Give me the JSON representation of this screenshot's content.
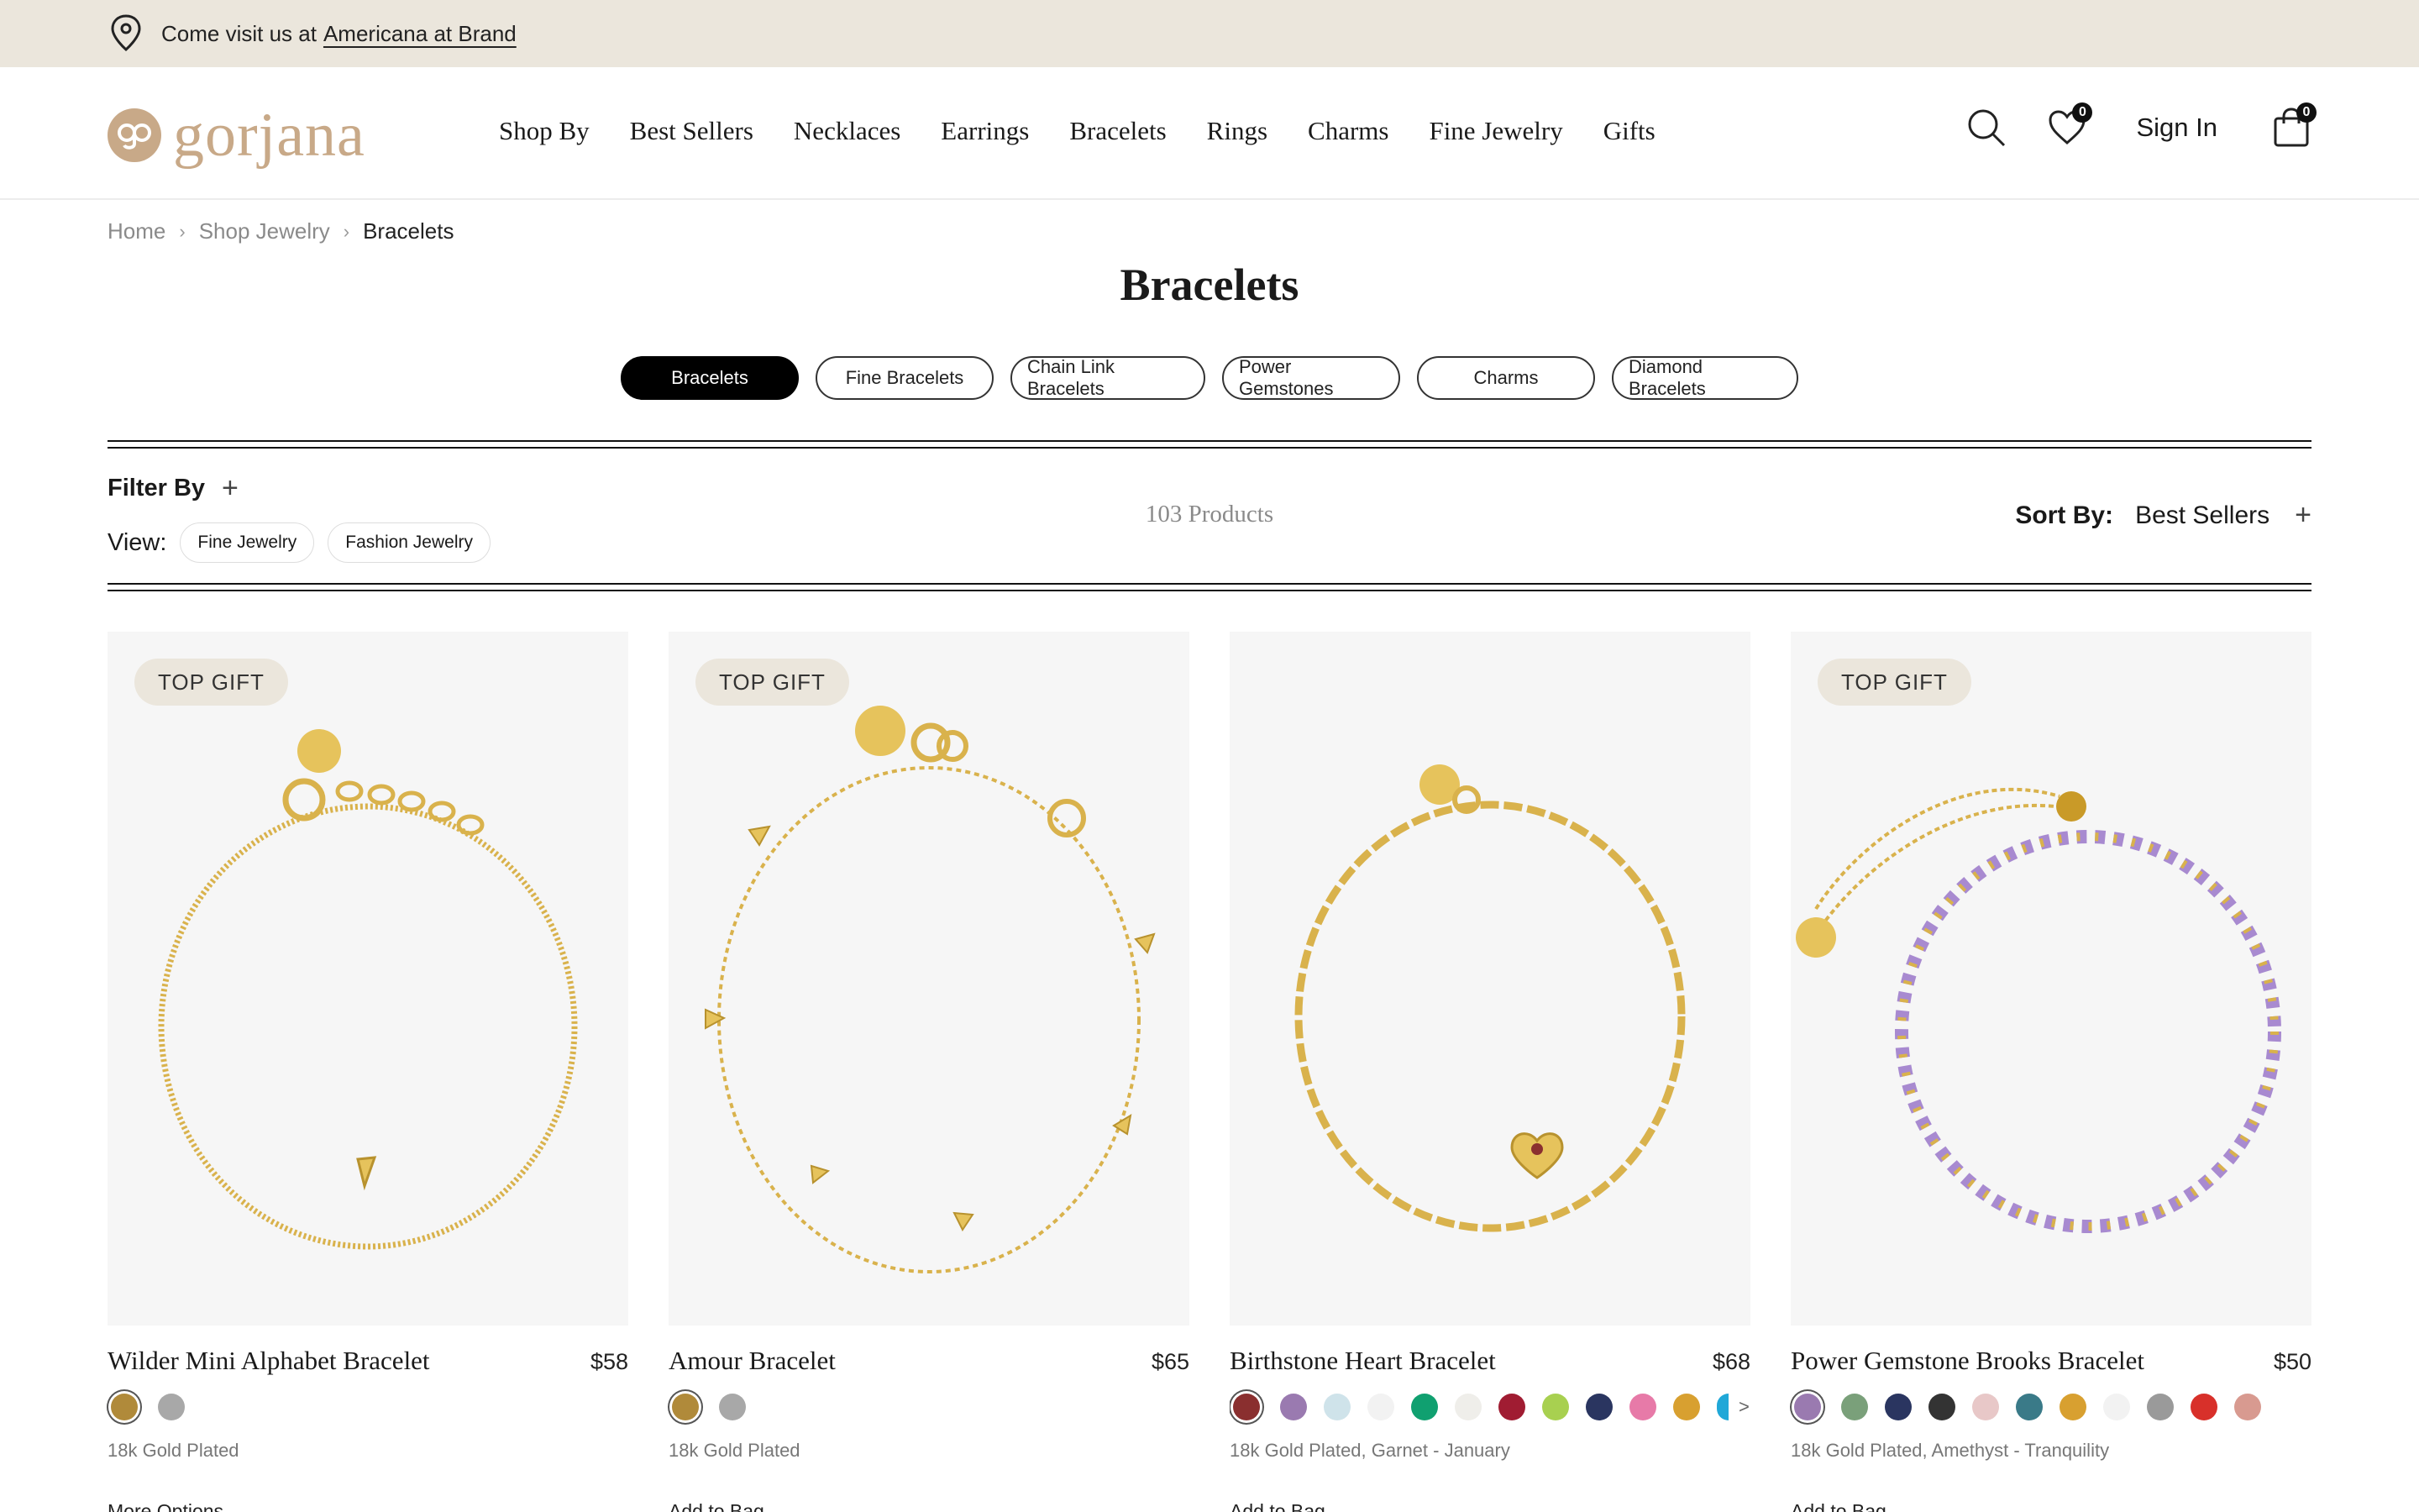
{
  "announcement": {
    "prefix": "Come visit us at",
    "link": "Americana at Brand"
  },
  "header": {
    "logo_text": "gorjana",
    "nav": [
      "Shop By",
      "Best Sellers",
      "Necklaces",
      "Earrings",
      "Bracelets",
      "Rings",
      "Charms",
      "Fine Jewelry",
      "Gifts"
    ],
    "wishlist_count": "0",
    "sign_in": "Sign In",
    "bag_count": "0"
  },
  "breadcrumb": [
    "Home",
    "Shop Jewelry",
    "Bracelets"
  ],
  "page_title": "Bracelets",
  "categories": [
    "Bracelets",
    "Fine Bracelets",
    "Chain Link Bracelets",
    "Power Gemstones",
    "Charms",
    "Diamond Bracelets"
  ],
  "active_category": "Bracelets",
  "filter": {
    "filter_label": "Filter By",
    "view_label": "View:",
    "view_options": [
      "Fine Jewelry",
      "Fashion Jewelry"
    ],
    "product_count": "103 Products",
    "sort_label": "Sort By:",
    "sort_value": "Best Sellers"
  },
  "products": [
    {
      "tag": "TOP GIFT",
      "name": "Wilder Mini Alphabet Bracelet",
      "price": "$58",
      "swatches": [
        "#b08a3a",
        "#a8a8a8"
      ],
      "more_swatches": "",
      "variant": "18k Gold Plated",
      "cta": "More Options"
    },
    {
      "tag": "TOP GIFT",
      "name": "Amour Bracelet",
      "price": "$65",
      "swatches": [
        "#b08a3a",
        "#a8a8a8"
      ],
      "more_swatches": "",
      "variant": "18k Gold Plated",
      "cta": "Add to Bag"
    },
    {
      "tag": "",
      "name": "Birthstone Heart Bracelet",
      "price": "$68",
      "swatches": [
        "#8a2f2f",
        "#9a7ab0",
        "#cfe3ea",
        "#f2f2f2",
        "#10a070",
        "#efeeea",
        "#a01c32",
        "#a8d050",
        "#2a3560",
        "#e77aa8",
        "#d8a030",
        "#20a8d8"
      ],
      "more_swatches": ">",
      "variant": "18k Gold Plated, Garnet - January",
      "cta": "Add to Bag"
    },
    {
      "tag": "TOP GIFT",
      "name": "Power Gemstone Brooks Bracelet",
      "price": "$50",
      "swatches": [
        "#9a7ab0",
        "#7aa07a",
        "#2a3560",
        "#333333",
        "#e8c8c8",
        "#3a7a88",
        "#d8a030",
        "#f2f2f2",
        "#9a9a9a",
        "#d8302a",
        "#d89a90"
      ],
      "more_swatches": "",
      "variant": "18k Gold Plated, Amethyst - Tranquility",
      "cta": "Add to Bag"
    }
  ],
  "colors": {
    "announce_bg": "#ebe6dc",
    "logo": "#c8a988",
    "gold": "#d9b24c"
  }
}
